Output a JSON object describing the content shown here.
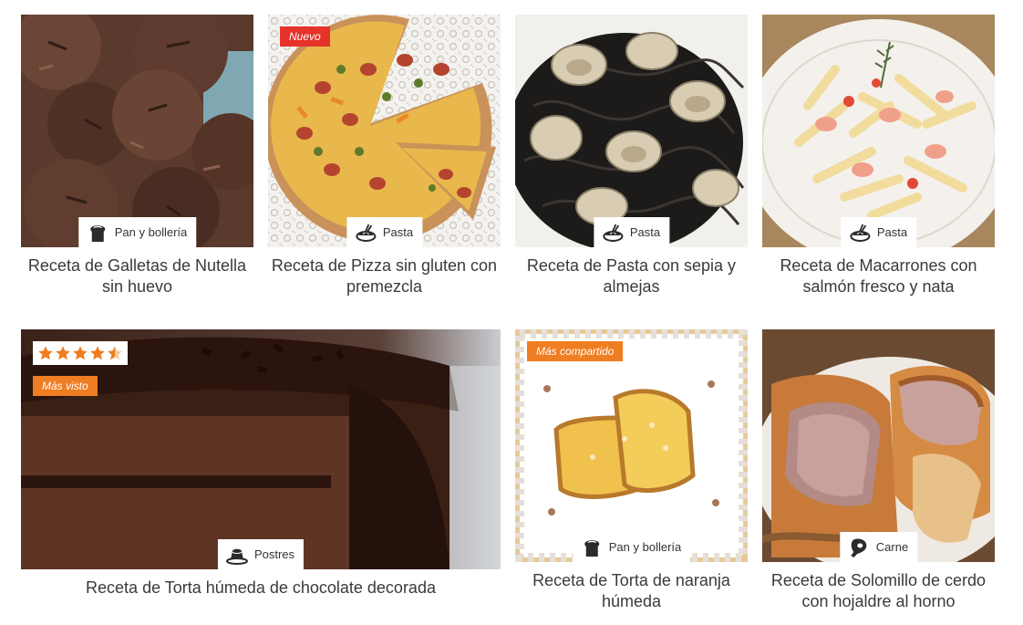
{
  "recipes": [
    {
      "title": "Receta de Galletas de Nutella sin huevo",
      "category": "Pan y bollería",
      "category_icon": "bread-icon",
      "badge": ""
    },
    {
      "title": "Receta de Pizza sin gluten con premezcla",
      "category": "Pasta",
      "category_icon": "pasta-icon",
      "badge": "Nuevo"
    },
    {
      "title": "Receta de Pasta con sepia y almejas",
      "category": "Pasta",
      "category_icon": "pasta-icon",
      "badge": ""
    },
    {
      "title": "Receta de Macarrones con salmón fresco y nata",
      "category": "Pasta",
      "category_icon": "pasta-icon",
      "badge": ""
    },
    {
      "title": "Receta de Torta húmeda de chocolate decorada",
      "category": "Postres",
      "category_icon": "pudding-icon",
      "badge": "Más visto",
      "rating": 4.5,
      "rating_max": 5
    },
    {
      "title": "Receta de Torta de naranja húmeda",
      "category": "Pan y bollería",
      "category_icon": "bread-icon",
      "badge": "Más compartido"
    },
    {
      "title": "Receta de Solomillo de cerdo con hojaldre al horno",
      "category": "Carne",
      "category_icon": "meat-icon",
      "badge": ""
    }
  ],
  "colors": {
    "badge_new": "#e6332a",
    "badge_popular": "#ef7d22",
    "star": "#ef7d22"
  }
}
